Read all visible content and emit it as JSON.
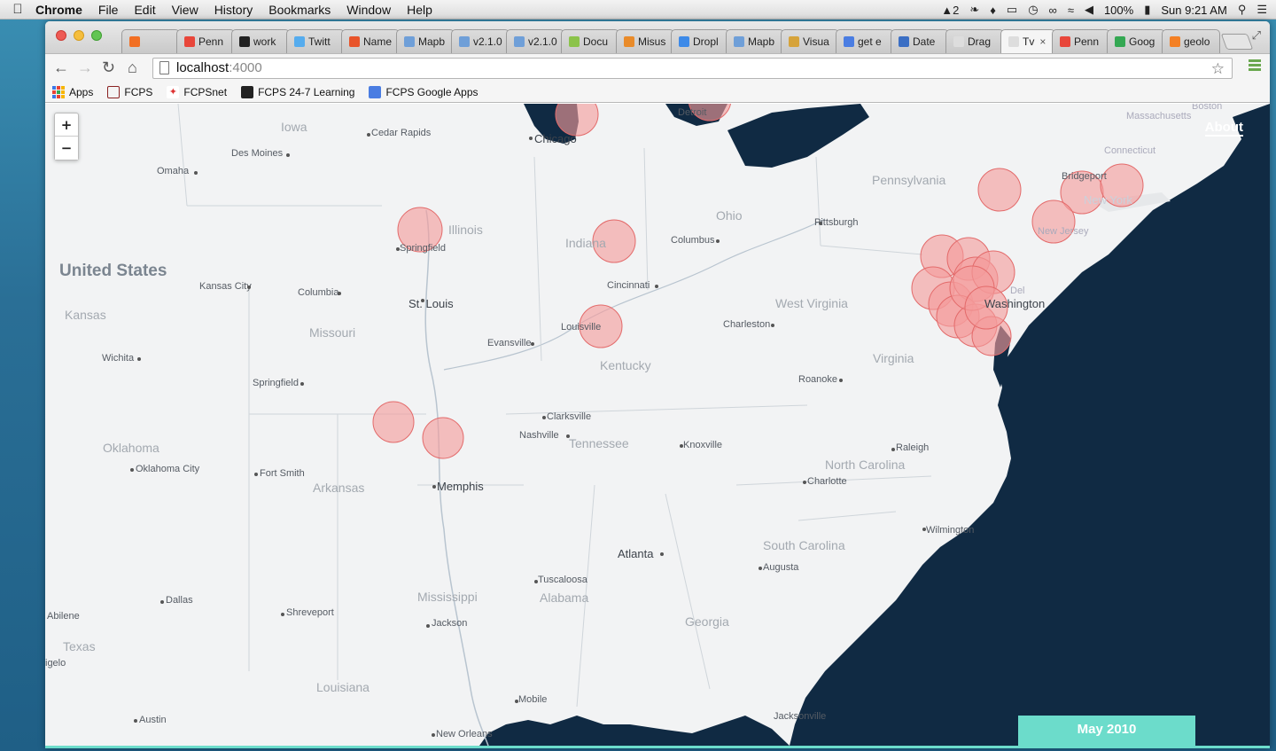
{
  "menubar": {
    "app_name": "Chrome",
    "items": [
      "File",
      "Edit",
      "View",
      "History",
      "Bookmarks",
      "Window",
      "Help"
    ],
    "status_count": "2",
    "battery": "100%",
    "clock": "Sun 9:21 AM"
  },
  "tabs": [
    {
      "label": "",
      "icon": "soundcloud-icon",
      "color": "#f26f23"
    },
    {
      "label": "Penn",
      "icon": "pinwheel-icon",
      "color": "#e8463a"
    },
    {
      "label": "work",
      "icon": "github-icon",
      "color": "#222222"
    },
    {
      "label": "Twitt",
      "icon": "twitter-icon",
      "color": "#55acee"
    },
    {
      "label": "Name",
      "icon": "namecheap-icon",
      "color": "#e8542a"
    },
    {
      "label": "Mapb",
      "icon": "mapbox-icon",
      "color": "#6f9fd8"
    },
    {
      "label": "v2.1.0",
      "icon": "mapbox-icon",
      "color": "#6f9fd8"
    },
    {
      "label": "v2.1.0",
      "icon": "mapbox-icon",
      "color": "#6f9fd8"
    },
    {
      "label": "Docu",
      "icon": "leaf-icon",
      "color": "#8bc34a"
    },
    {
      "label": "Misus",
      "icon": "pen-icon",
      "color": "#e98b2a"
    },
    {
      "label": "Dropl",
      "icon": "dropbox-icon",
      "color": "#3d8ae8"
    },
    {
      "label": "Mapb",
      "icon": "mapbox-icon",
      "color": "#6f9fd8"
    },
    {
      "label": "Visua",
      "icon": "visual-icon",
      "color": "#d6a33a"
    },
    {
      "label": "get e",
      "icon": "google-icon",
      "color": "#4a7de2"
    },
    {
      "label": "Date",
      "icon": "date-icon",
      "color": "#3b6fc4"
    },
    {
      "label": "Drag",
      "icon": "page-icon",
      "color": "#dddddd"
    },
    {
      "label": "Tv",
      "icon": "page-icon",
      "color": "#dddddd",
      "active": true
    },
    {
      "label": "Penn",
      "icon": "pinwheel-icon",
      "color": "#e8463a"
    },
    {
      "label": "Goog",
      "icon": "google-maps-icon",
      "color": "#34a853"
    },
    {
      "label": "geolo",
      "icon": "stackoverflow-icon",
      "color": "#f48024"
    }
  ],
  "address": {
    "host": "localhost",
    "port": ":4000"
  },
  "bookmarks": [
    {
      "label": "Apps",
      "icon": "apps-icon"
    },
    {
      "label": "FCPS",
      "icon": "fcps-icon"
    },
    {
      "label": "FCPSnet",
      "icon": "fcpsnet-icon"
    },
    {
      "label": "FCPS 24-7 Learning",
      "icon": "blackboard-icon"
    },
    {
      "label": "FCPS Google Apps",
      "icon": "google-apps-icon"
    }
  ],
  "map": {
    "zoom_in": "+",
    "zoom_out": "−",
    "about": "About",
    "date": "May 2010",
    "colors": {
      "land": "#f2f3f4",
      "water": "#102a43",
      "circle_fill": "#f39b9b",
      "circle_stroke": "#e36a6a",
      "accent": "#6cdccb"
    },
    "country_labels": [
      "United States"
    ],
    "state_labels": [
      "Iowa",
      "Illinois",
      "Indiana",
      "Ohio",
      "Pennsylvania",
      "Kansas",
      "Missouri",
      "Kentucky",
      "West Virginia",
      "Virginia",
      "Oklahoma",
      "Arkansas",
      "Tennessee",
      "North Carolina",
      "South Carolina",
      "Mississippi",
      "Alabama",
      "Georgia",
      "Texas",
      "Louisiana",
      "Massachusetts",
      "Connecticut",
      "New Jersey",
      "Del"
    ],
    "city_labels": [
      "Cedar Rapids",
      "Des Moines",
      "Omaha",
      "Chicago",
      "Detroit",
      "Springfield",
      "Kansas City",
      "Columbia",
      "St. Louis",
      "Cincinnati",
      "Columbus",
      "Pittsburgh",
      "Charleston",
      "Evansville",
      "Louisville",
      "Wichita",
      "Springfield",
      "Clarksville",
      "Nashville",
      "Knoxville",
      "Roanoke",
      "Raleigh",
      "Oklahoma City",
      "Fort Smith",
      "Memphis",
      "Charlotte",
      "Wilmington",
      "Atlanta",
      "Augusta",
      "Tuscaloosa",
      "Dallas",
      "Shreveport",
      "Jackson",
      "Abilene",
      "Austin",
      "Mobile",
      "New Orleans",
      "Jacksonville",
      "Boston",
      "Bridgeport",
      "New York",
      "Washington",
      "igelo"
    ]
  }
}
